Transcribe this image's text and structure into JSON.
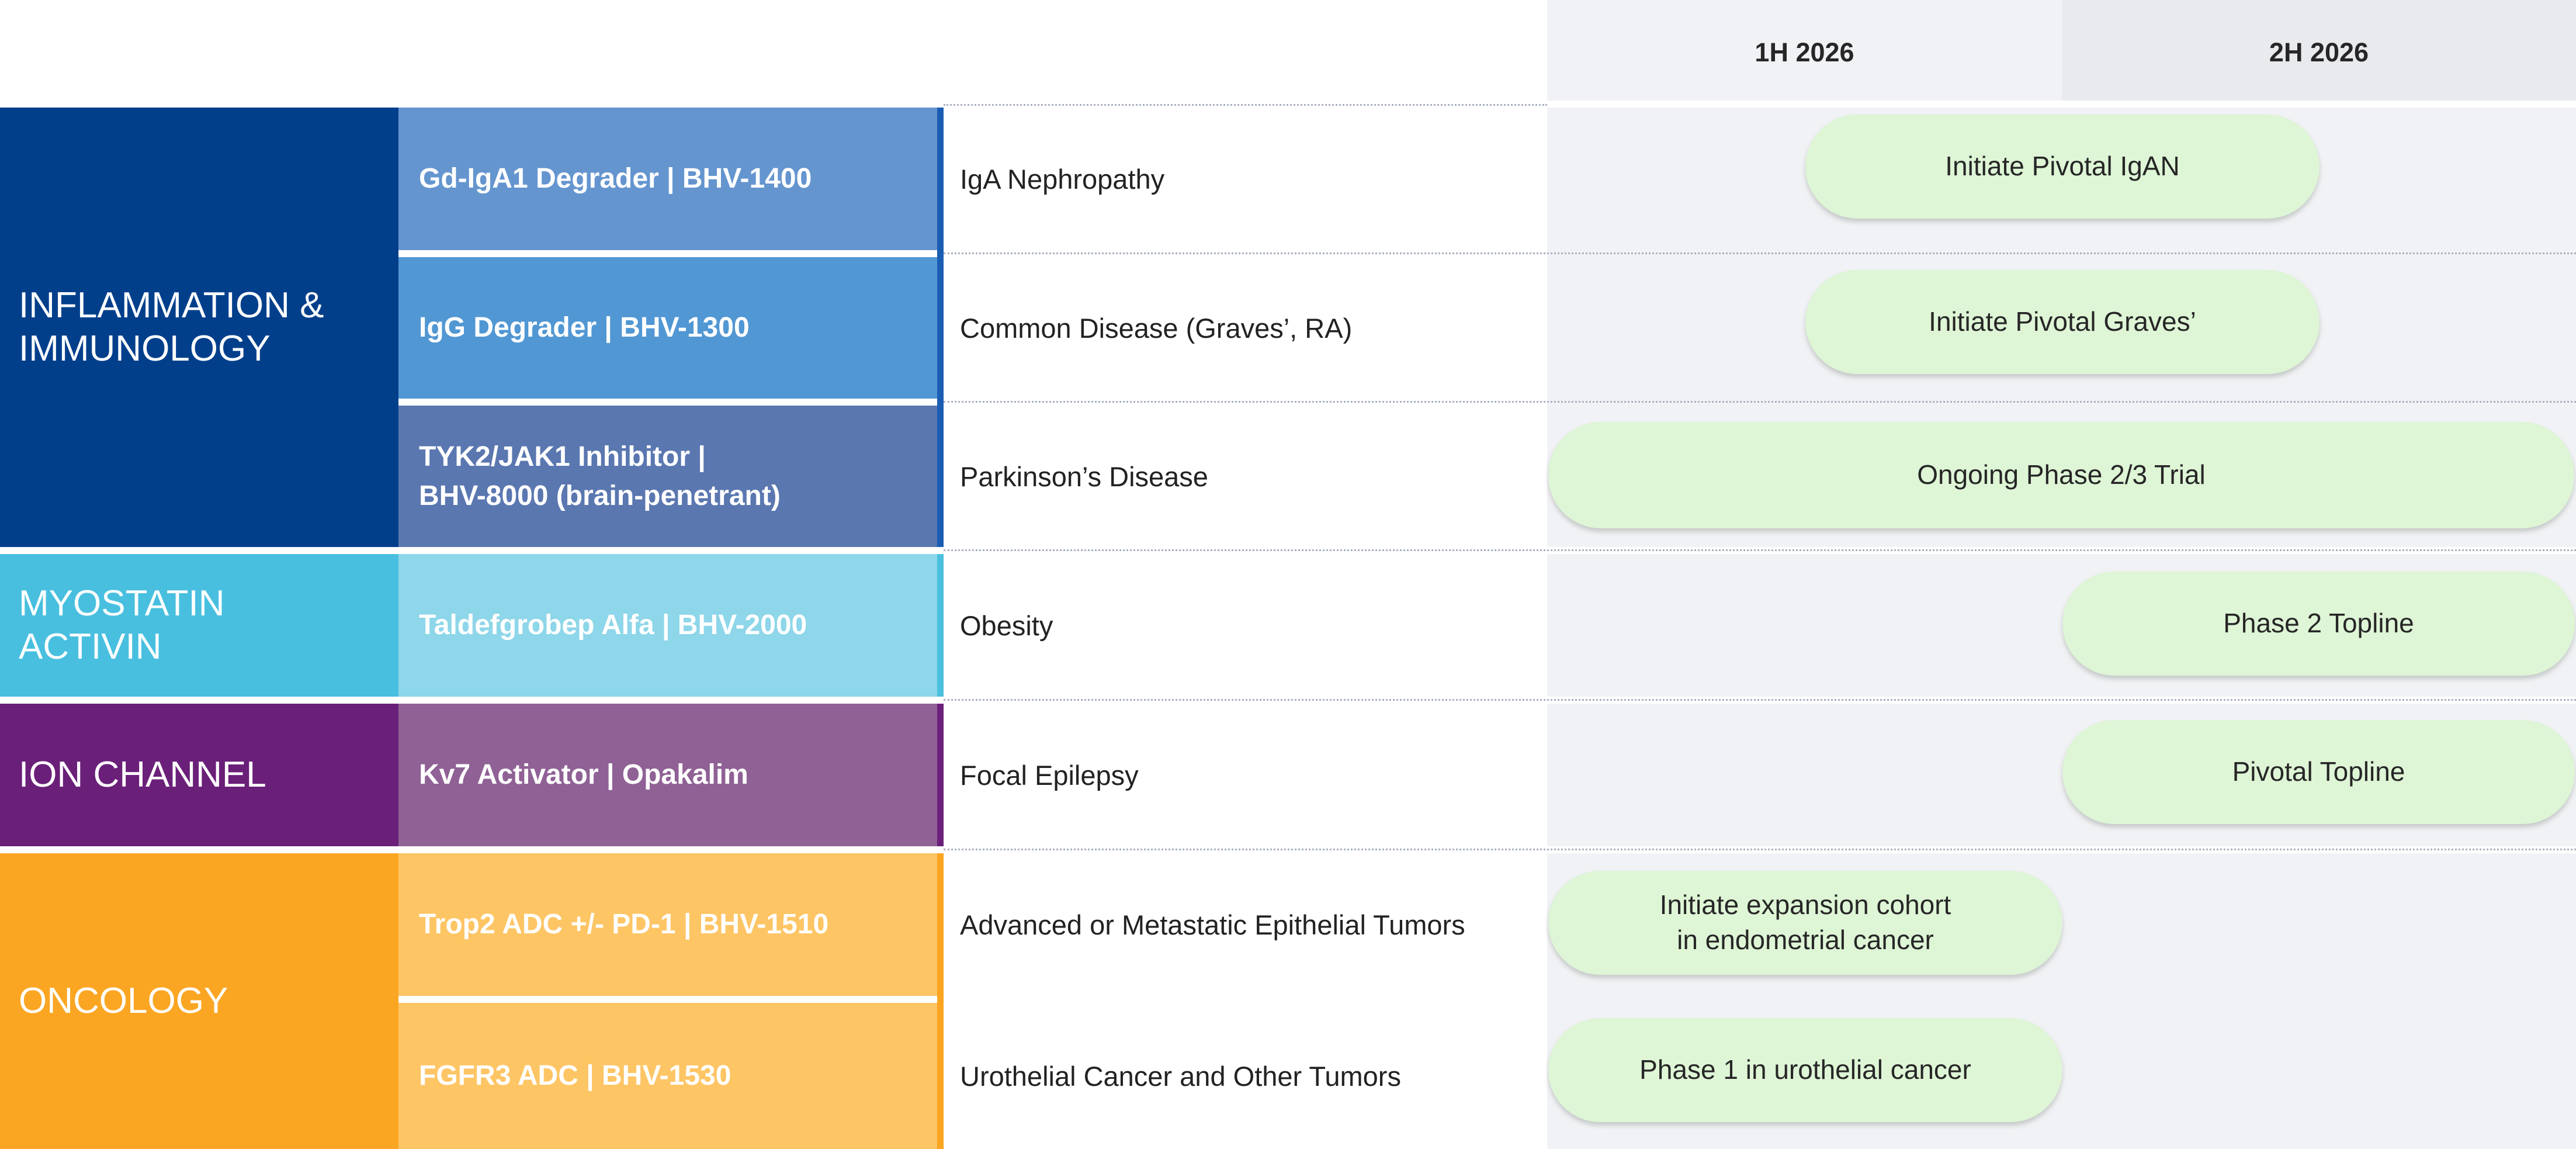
{
  "timeline": {
    "periods": [
      "1H 2026",
      "2H 2026"
    ]
  },
  "colors": {
    "inflammation": "#023f8b",
    "inflammation_program_1": "#6495cf",
    "inflammation_program_2": "#5197d3",
    "inflammation_program_3": "#5a77b0",
    "inflammation_accent": "#1c5db4",
    "myostatin": "#48bfdf",
    "myostatin_program": "#8ed6e9",
    "myostatin_accent": "#4ac0de",
    "ion_channel": "#6a1f79",
    "ion_channel_program": "#8f6195",
    "ion_channel_accent": "#6c2079",
    "oncology": "#fba622",
    "oncology_program": "#fec565",
    "oncology_accent": "#fca520",
    "milestone_fill": "#def5d6"
  },
  "categories": [
    {
      "label": "INFLAMMATION &\nIMMUNOLOGY"
    },
    {
      "label": "MYOSTATIN\nACTIVIN"
    },
    {
      "label": "ION CHANNEL"
    },
    {
      "label": "ONCOLOGY"
    }
  ],
  "rows": [
    {
      "program": "Gd-IgA1 Degrader  |  BHV-1400",
      "indication": "IgA Nephropathy",
      "milestone": "Initiate Pivotal IgAN"
    },
    {
      "program": "IgG Degrader |  BHV-1300",
      "indication": "Common Disease (Graves’, RA)",
      "milestone": "Initiate Pivotal Graves’"
    },
    {
      "program": "TYK2/JAK1 Inhibitor  |\nBHV-8000 (brain-penetrant)",
      "indication": "Parkinson’s Disease",
      "milestone": "Ongoing Phase 2/3 Trial"
    },
    {
      "program": "Taldefgrobep Alfa | BHV-2000",
      "indication": "Obesity",
      "milestone": "Phase 2 Topline"
    },
    {
      "program": "Kv7 Activator | Opakalim",
      "indication": "Focal Epilepsy",
      "milestone": "Pivotal Topline"
    },
    {
      "program": "Trop2 ADC +/- PD-1 | BHV-1510",
      "indication": "Advanced or Metastatic Epithelial Tumors",
      "milestone": "Initiate expansion cohort\nin endometrial cancer"
    },
    {
      "program": "FGFR3  ADC | BHV-1530",
      "indication": "Urothelial Cancer and Other Tumors",
      "milestone": "Phase 1 in urothelial cancer"
    }
  ]
}
